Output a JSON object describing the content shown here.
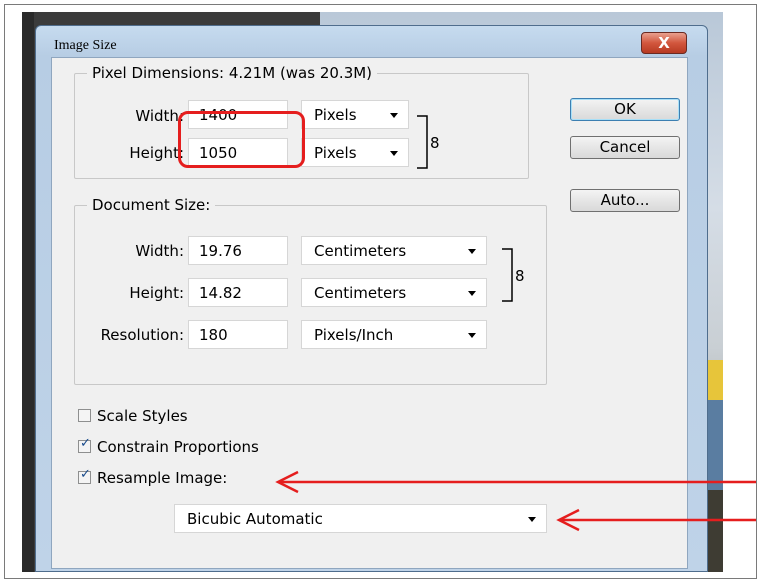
{
  "dialog": {
    "title": "Image Size",
    "close_label": "X"
  },
  "pixel_dimensions": {
    "title": "Pixel Dimensions:  4.21M (was 20.3M)",
    "width_label": "Width:",
    "width_value": "1400",
    "width_unit": "Pixels",
    "height_label": "Height:",
    "height_value": "1050",
    "height_unit": "Pixels"
  },
  "document_size": {
    "title": "Document Size:",
    "width_label": "Width:",
    "width_value": "19.76",
    "width_unit": "Centimeters",
    "height_label": "Height:",
    "height_value": "14.82",
    "height_unit": "Centimeters",
    "resolution_label": "Resolution:",
    "resolution_value": "180",
    "resolution_unit": "Pixels/Inch"
  },
  "buttons": {
    "ok": "OK",
    "cancel": "Cancel",
    "auto": "Auto..."
  },
  "options": {
    "scale_styles": {
      "label": "Scale Styles",
      "checked": false
    },
    "constrain_proportions": {
      "label": "Constrain Proportions",
      "checked": true
    },
    "resample_image": {
      "label": "Resample Image:",
      "checked": true
    },
    "resample_method": "Bicubic Automatic"
  },
  "icons": [
    "close-icon",
    "chain-link-icon",
    "dropdown-arrow-icon",
    "checkmark-icon"
  ],
  "colors": {
    "annotation_red": "#e51e1e",
    "title_bar": "#b7cde4",
    "client_bg": "#f0f0f0"
  }
}
